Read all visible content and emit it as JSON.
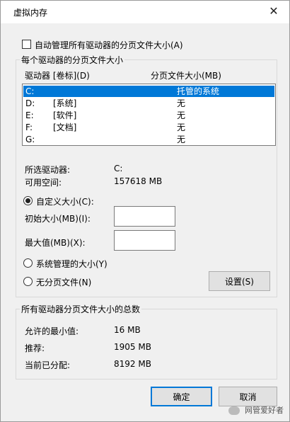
{
  "window": {
    "title": "虚拟内存"
  },
  "auto_manage": {
    "label": "自动管理所有驱动器的分页文件大小(A)",
    "checked": false
  },
  "drives_group": {
    "title": "每个驱动器的分页文件大小",
    "columns": {
      "drive": "驱动器 [卷标](D)",
      "size": "分页文件大小(MB)"
    },
    "rows": [
      {
        "drive": "C:",
        "label": "",
        "size": "托管的系统",
        "selected": true
      },
      {
        "drive": "D:",
        "label": "[系统]",
        "size": "无",
        "selected": false
      },
      {
        "drive": "E:",
        "label": "[软件]",
        "size": "无",
        "selected": false
      },
      {
        "drive": "F:",
        "label": "[文档]",
        "size": "无",
        "selected": false
      },
      {
        "drive": "G:",
        "label": "",
        "size": "无",
        "selected": false
      }
    ],
    "selected_drive_label": "所选驱动器:",
    "selected_drive_value": "C:",
    "free_space_label": "可用空间:",
    "free_space_value": "157618 MB",
    "custom_size_label": "自定义大小(C):",
    "initial_size_label": "初始大小(MB)(I):",
    "initial_size_value": "",
    "max_size_label": "最大值(MB)(X):",
    "max_size_value": "",
    "system_managed_label": "系统管理的大小(Y)",
    "no_paging_label": "无分页文件(N)",
    "set_button": "设置(S)",
    "selected_option": "custom"
  },
  "totals_group": {
    "title": "所有驱动器分页文件大小的总数",
    "min_allowed_label": "允许的最小值:",
    "min_allowed_value": "16 MB",
    "recommended_label": "推荐:",
    "recommended_value": "1905 MB",
    "current_label": "当前已分配:",
    "current_value": "8192 MB"
  },
  "buttons": {
    "ok": "确定",
    "cancel": "取消"
  },
  "watermark": {
    "text": "网管爱好者"
  },
  "colors": {
    "selection": "#0078d7",
    "background": "#f0f0f0"
  }
}
